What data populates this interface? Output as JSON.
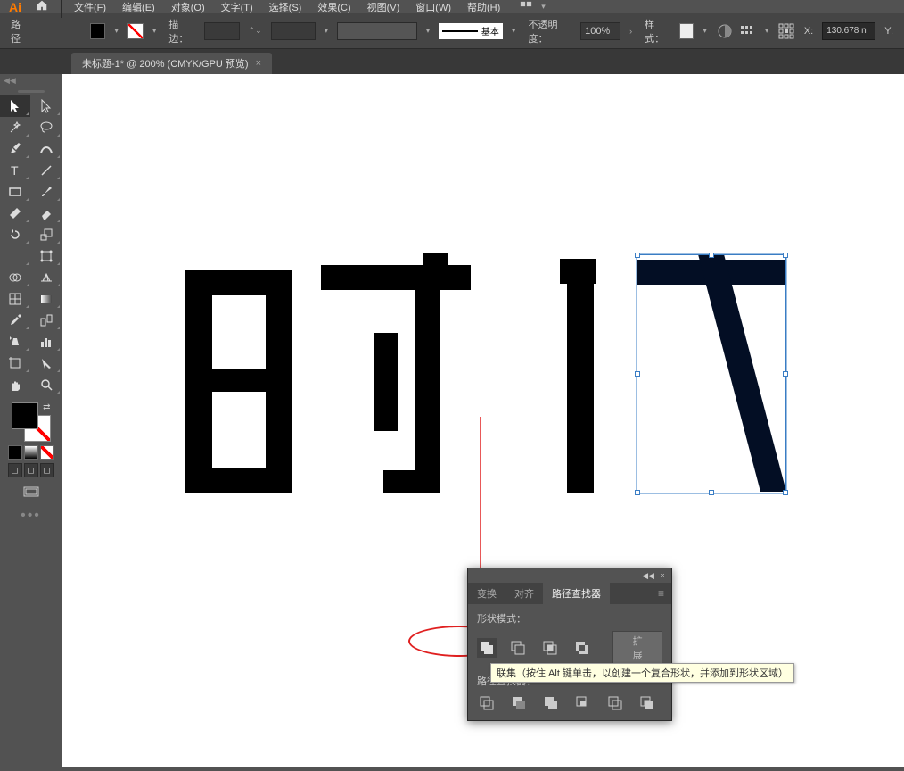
{
  "app": {
    "logo": "Ai"
  },
  "menu": {
    "file": "文件(F)",
    "edit": "编辑(E)",
    "object": "对象(O)",
    "type": "文字(T)",
    "select": "选择(S)",
    "effect": "效果(C)",
    "view": "视图(V)",
    "window": "窗口(W)",
    "help": "帮助(H)"
  },
  "controlbar": {
    "type_label": "路径",
    "stroke_label": "描边：",
    "stroke_style_label": "基本",
    "opacity_label": "不透明度：",
    "opacity_value": "100%",
    "style_label": "样式：",
    "x_label": "X:",
    "x_value": "130.678 n",
    "y_label": "Y:"
  },
  "document": {
    "tab_title": "未标题-1* @ 200% (CMYK/GPU 预览)"
  },
  "panel": {
    "tabs": {
      "transform": "变换",
      "align": "对齐",
      "pathfinder": "路径查找器"
    },
    "shape_mode_label": "形状模式：",
    "pathfinder_label": "路径查找器：",
    "expand_button": "扩展"
  },
  "tooltip": {
    "text": "联集（按住 Alt 键单击，以创建一个复合形状，并添加到形状区域）"
  }
}
